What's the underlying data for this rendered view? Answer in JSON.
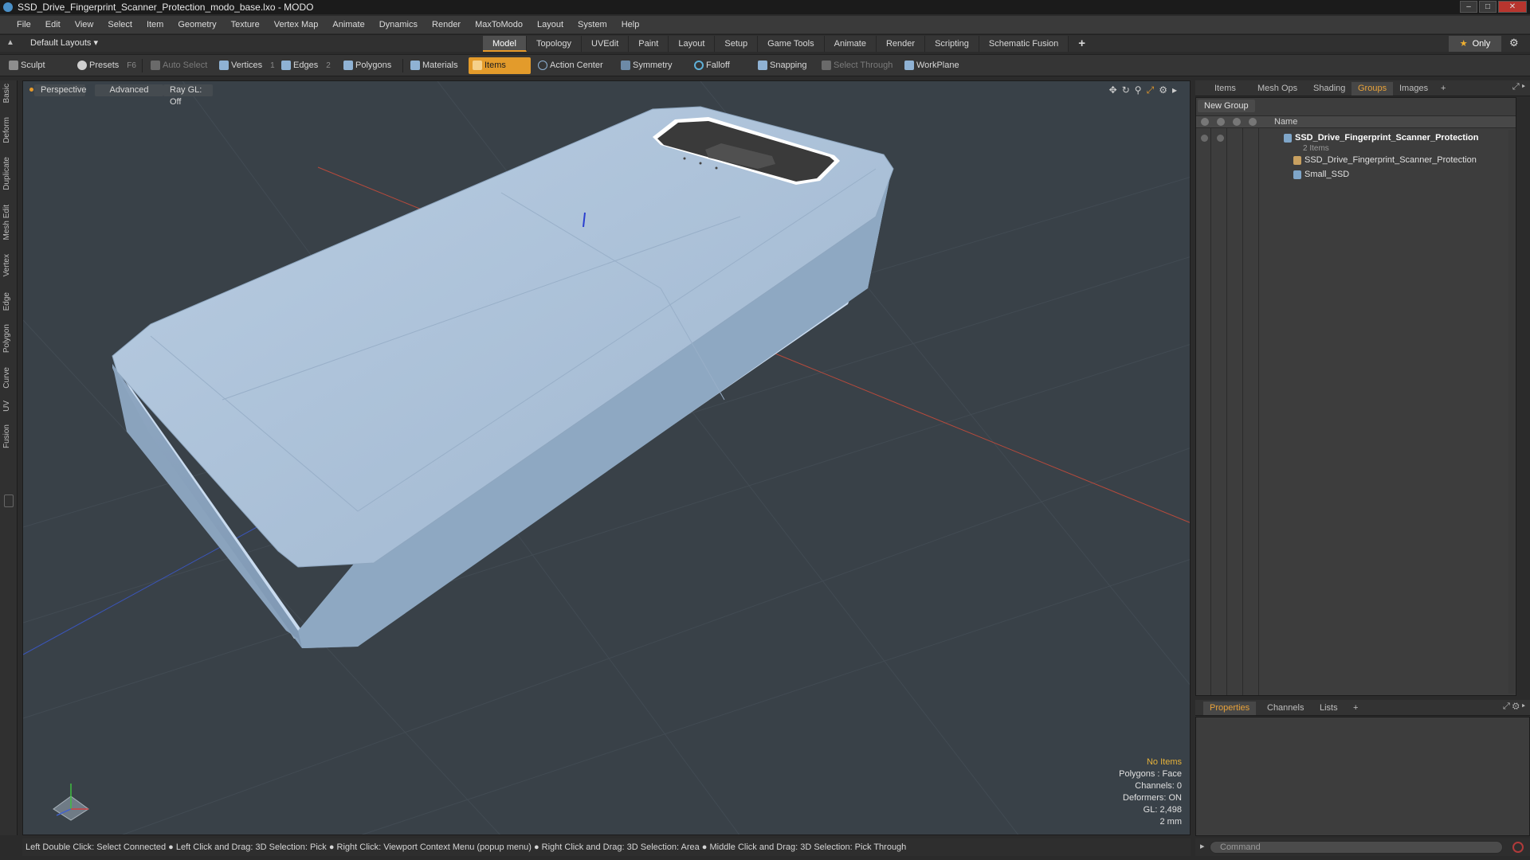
{
  "window": {
    "title": "SSD_Drive_Fingerprint_Scanner_Protection_modo_base.lxo - MODO"
  },
  "menu": [
    "File",
    "Edit",
    "View",
    "Select",
    "Item",
    "Geometry",
    "Texture",
    "Vertex Map",
    "Animate",
    "Dynamics",
    "Render",
    "MaxToModo",
    "Layout",
    "System",
    "Help"
  ],
  "layoutbar": {
    "layout_dropdown": "Default Layouts",
    "tabs": [
      "Model",
      "Topology",
      "UVEdit",
      "Paint",
      "Layout",
      "Setup",
      "Game Tools",
      "Animate",
      "Render",
      "Scripting",
      "Schematic Fusion"
    ],
    "active_tab": "Model",
    "only_label": "Only"
  },
  "toolbar": {
    "sculpt": "Sculpt",
    "presets": "Presets",
    "presets_key": "F6",
    "auto_select": "Auto Select",
    "vertices": "Vertices",
    "vertices_count": "1",
    "edges": "Edges",
    "edges_count": "2",
    "polygons": "Polygons",
    "materials": "Materials",
    "items": "Items",
    "action_center": "Action Center",
    "symmetry": "Symmetry",
    "falloff": "Falloff",
    "snapping": "Snapping",
    "select_through": "Select Through",
    "workplane": "WorkPlane"
  },
  "left_strip": [
    "Basic",
    "Deform",
    "Duplicate",
    "Mesh Edit",
    "Vertex",
    "Edge",
    "Polygon",
    "Curve",
    "UV",
    "Fusion"
  ],
  "viewport": {
    "view_mode": "Perspective",
    "shading": "Advanced",
    "raygl": "Ray GL: Off",
    "info": {
      "items": "No Items",
      "polygons": "Polygons : Face",
      "channels": "Channels: 0",
      "deformers": "Deformers: ON",
      "gl": "GL: 2,498",
      "unit": "2 mm"
    }
  },
  "status_bar": "Left Double Click: Select Connected ● Left Click and Drag: 3D Selection: Pick ● Right Click: Viewport Context Menu (popup menu) ● Right Click and Drag: 3D Selection: Area ● Middle Click and Drag: 3D Selection: Pick Through",
  "right_panel": {
    "tabs": [
      "Items",
      "Mesh Ops",
      "Shading",
      "Groups",
      "Images"
    ],
    "active_tab": "Groups",
    "new_group": "New Group",
    "name_col": "Name",
    "group": {
      "name": "SSD_Drive_Fingerprint_Scanner_Protection",
      "count": "2 Items",
      "children": [
        "SSD_Drive_Fingerprint_Scanner_Protection",
        "Small_SSD"
      ]
    },
    "bottom_tabs": [
      "Properties",
      "Channels",
      "Lists"
    ],
    "bottom_active": "Properties",
    "command_placeholder": "Command"
  },
  "colors": {
    "accent": "#e39b2b",
    "model_surface": "#a9c0d8",
    "viewport_bg": "#394148"
  }
}
